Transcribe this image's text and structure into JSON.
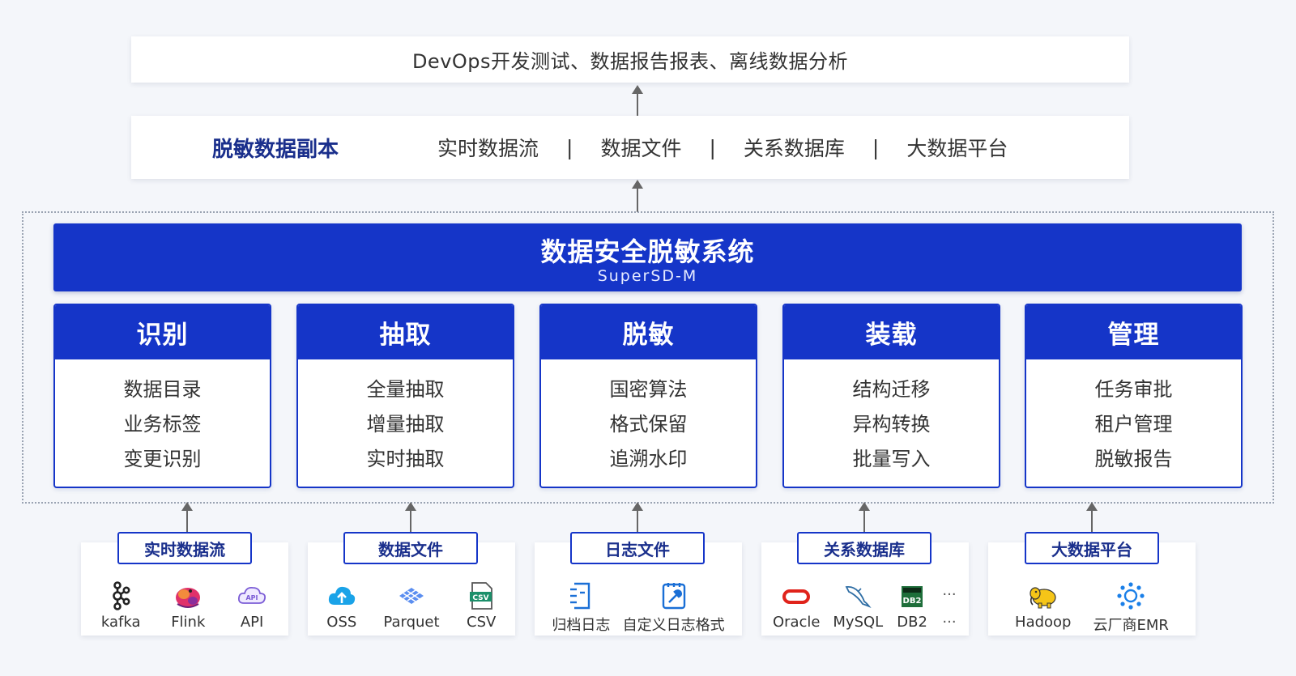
{
  "usage": {
    "text": "DevOps开发测试、数据报告报表、离线数据分析"
  },
  "replica": {
    "title": "脱敏数据副本",
    "items": [
      "实时数据流",
      "数据文件",
      "关系数据库",
      "大数据平台"
    ],
    "separator": "|"
  },
  "system": {
    "title": "数据安全脱敏系统",
    "subtitle": "SuperSD-M"
  },
  "modules": [
    {
      "title": "识别",
      "items": [
        "数据目录",
        "业务标签",
        "变更识别"
      ]
    },
    {
      "title": "抽取",
      "items": [
        "全量抽取",
        "增量抽取",
        "实时抽取"
      ]
    },
    {
      "title": "脱敏",
      "items": [
        "国密算法",
        "格式保留",
        "追溯水印"
      ]
    },
    {
      "title": "装载",
      "items": [
        "结构迁移",
        "异构转换",
        "批量写入"
      ]
    },
    {
      "title": "管理",
      "items": [
        "任务审批",
        "租户管理",
        "脱敏报告"
      ]
    }
  ],
  "sources": [
    {
      "label": "实时数据流",
      "icons": [
        {
          "name": "kafka-icon",
          "label": "kafka"
        },
        {
          "name": "flink-icon",
          "label": "Flink"
        },
        {
          "name": "api-icon",
          "label": "API"
        }
      ]
    },
    {
      "label": "数据文件",
      "icons": [
        {
          "name": "oss-icon",
          "label": "OSS"
        },
        {
          "name": "parquet-icon",
          "label": "Parquet"
        },
        {
          "name": "csv-icon",
          "label": "CSV"
        }
      ]
    },
    {
      "label": "日志文件",
      "icons": [
        {
          "name": "archive-log-icon",
          "label": "归档日志"
        },
        {
          "name": "custom-log-icon",
          "label": "自定义日志格式"
        }
      ]
    },
    {
      "label": "关系数据库",
      "icons": [
        {
          "name": "oracle-icon",
          "label": "Oracle"
        },
        {
          "name": "mysql-icon",
          "label": "MySQL"
        },
        {
          "name": "db2-icon",
          "label": "DB2"
        }
      ],
      "more": "···"
    },
    {
      "label": "大数据平台",
      "icons": [
        {
          "name": "hadoop-icon",
          "label": "Hadoop"
        },
        {
          "name": "emr-icon",
          "label": "云厂商EMR"
        }
      ]
    }
  ],
  "colors": {
    "primary": "#1535c8",
    "title_text": "#1a2f8c"
  }
}
